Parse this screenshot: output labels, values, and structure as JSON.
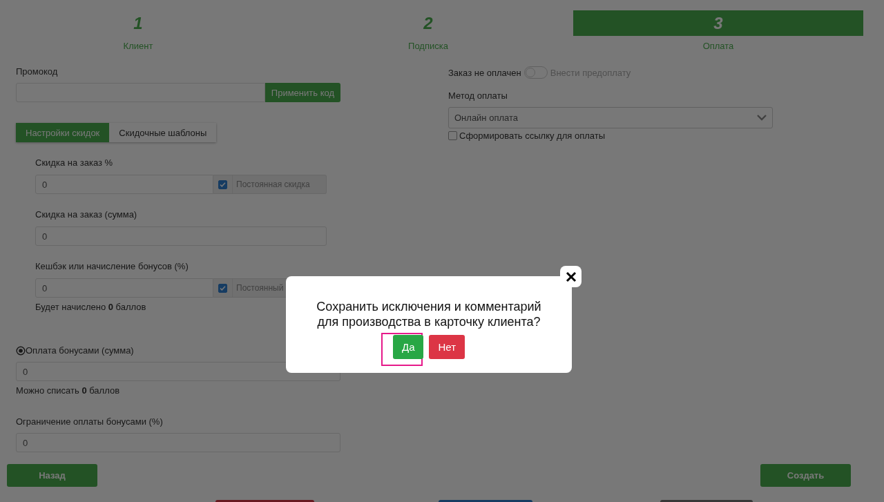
{
  "steps": [
    {
      "number": "1",
      "label": "Клиент",
      "selected": false
    },
    {
      "number": "2",
      "label": "Подписка",
      "selected": false
    },
    {
      "number": "3",
      "label": "Оплата",
      "selected": true
    }
  ],
  "promo": {
    "label": "Промокод",
    "button": "Применить код"
  },
  "discount_tabs": [
    {
      "label": "Настройки скидок",
      "selected": true
    },
    {
      "label": "Скидочные шаблоны",
      "selected": false
    }
  ],
  "discount_fields": [
    {
      "kind": "addon",
      "label": "Скидка на заказ %",
      "value": "0",
      "addon": {
        "label": "Постоянная скидка",
        "checked": true
      }
    },
    {
      "kind": "plain",
      "label": "Скидка на заказ (сумма)",
      "value": "0"
    },
    {
      "kind": "addon",
      "label": "Кешбэк или начисление бонусов (%)",
      "value": "0",
      "addon": {
        "label": "Постоянный",
        "checked": true
      },
      "note": "Будет начислено **0** баллов"
    }
  ],
  "bonus_payment": {
    "label": "Оплата бонусами (сумма)",
    "value": "0",
    "note": "Можно списать **0** баллов"
  },
  "bonus_limit": {
    "label": "Ограничение оплаты бонусами (%)",
    "value": "0"
  },
  "payment": {
    "status_label": "Заказ не оплачен",
    "toggle_on": false,
    "toggle_label": "Внести предоплату",
    "method_label": "Метод оплаты",
    "method_value": "Онлайн оплата",
    "link_checkbox": {
      "label": "Сформировать ссылку для оплаты",
      "checked": false
    }
  },
  "nav": {
    "back": "Назад",
    "create": "Создать"
  },
  "dialog": {
    "message": "Сохранить исключения и комментарий для производства в карточку клиента?",
    "buttons": [
      {
        "kind": "confirm",
        "label": "Да",
        "highlighted": true
      },
      {
        "kind": "cancel",
        "label": "Нет",
        "highlighted": false
      }
    ]
  }
}
